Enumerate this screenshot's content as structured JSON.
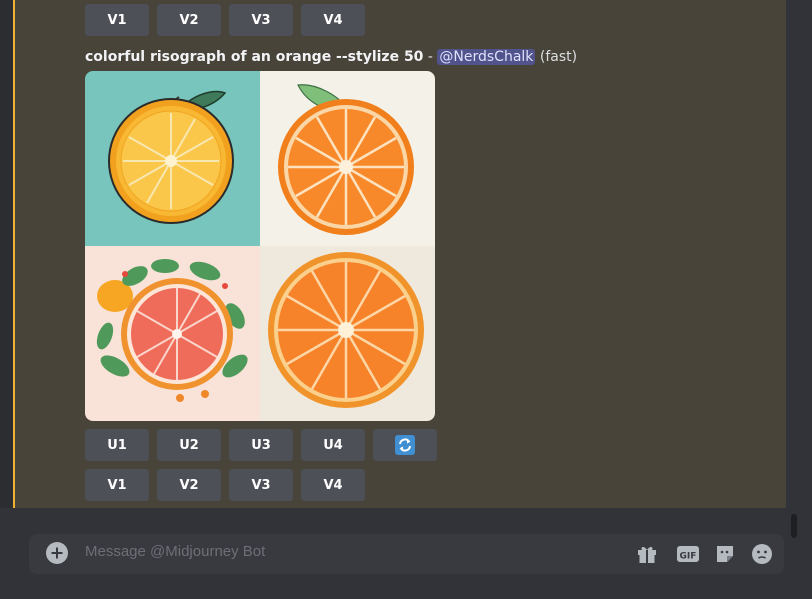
{
  "buttons_top": [
    "V1",
    "V2",
    "V3",
    "V4"
  ],
  "message": {
    "prompt": "colorful risograph of an orange --stylize 50",
    "separator": " - ",
    "mention": "@NerdsChalk",
    "mode": "(fast)"
  },
  "image_grid": {
    "tiles": [
      {
        "name": "orange-variation-1",
        "bg": "#78c5bd"
      },
      {
        "name": "orange-variation-2",
        "bg": "#f4f1e9"
      },
      {
        "name": "orange-variation-3",
        "bg": "#f9e2d8"
      },
      {
        "name": "orange-variation-4",
        "bg": "#efe9dd"
      }
    ]
  },
  "buttons_u": [
    "U1",
    "U2",
    "U3",
    "U4"
  ],
  "reroll_icon": "refresh-icon",
  "buttons_v": [
    "V1",
    "V2",
    "V3",
    "V4"
  ],
  "composer": {
    "placeholder": "Message @Midjourney Bot",
    "icons": [
      "plus-icon",
      "gift-icon",
      "gif-icon",
      "sticker-icon",
      "emoji-icon"
    ]
  },
  "colors": {
    "highlight_bg": "#49443a",
    "highlight_border": "#f0b232",
    "button_bg": "#4e5058",
    "mention_bg": "#5865f2"
  }
}
